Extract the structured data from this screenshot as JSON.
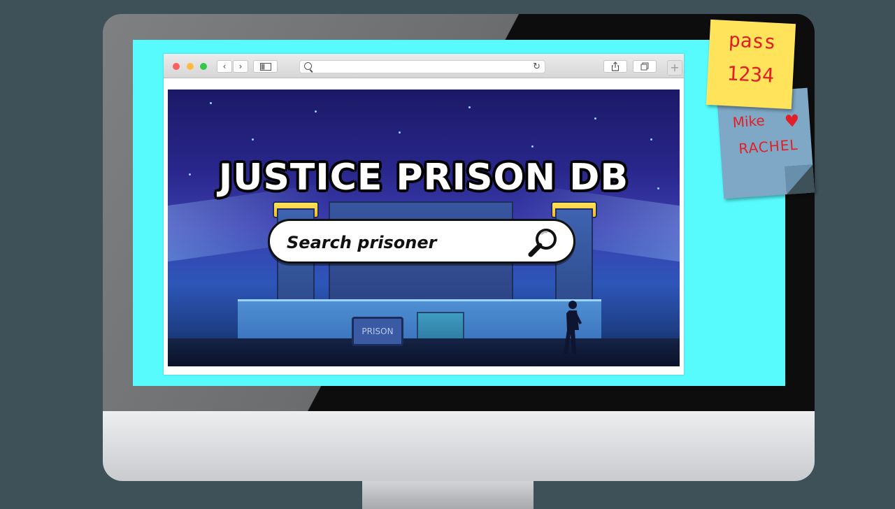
{
  "browser": {
    "address_placeholder": "",
    "nav_back_glyph": "‹",
    "nav_forward_glyph": "›",
    "new_tab_glyph": "+"
  },
  "page": {
    "title": "JUSTICE PRISON DB",
    "search_placeholder": "Search prisoner",
    "sign_text": "PRISON"
  },
  "sticky_notes": {
    "yellow": [
      "pass",
      "1234"
    ],
    "blue": {
      "line1": "Mike",
      "line2": "RACHEL"
    }
  },
  "colors": {
    "screen_background": "#57fbfd",
    "note_text": "#e21f26",
    "yellow_note": "#ffe35a",
    "blue_note": "#7ea8c5"
  },
  "icons": [
    "search-icon",
    "reload-icon",
    "share-icon",
    "tabs-icon",
    "sidebar-icon",
    "magnifier-icon",
    "heart-icon"
  ]
}
